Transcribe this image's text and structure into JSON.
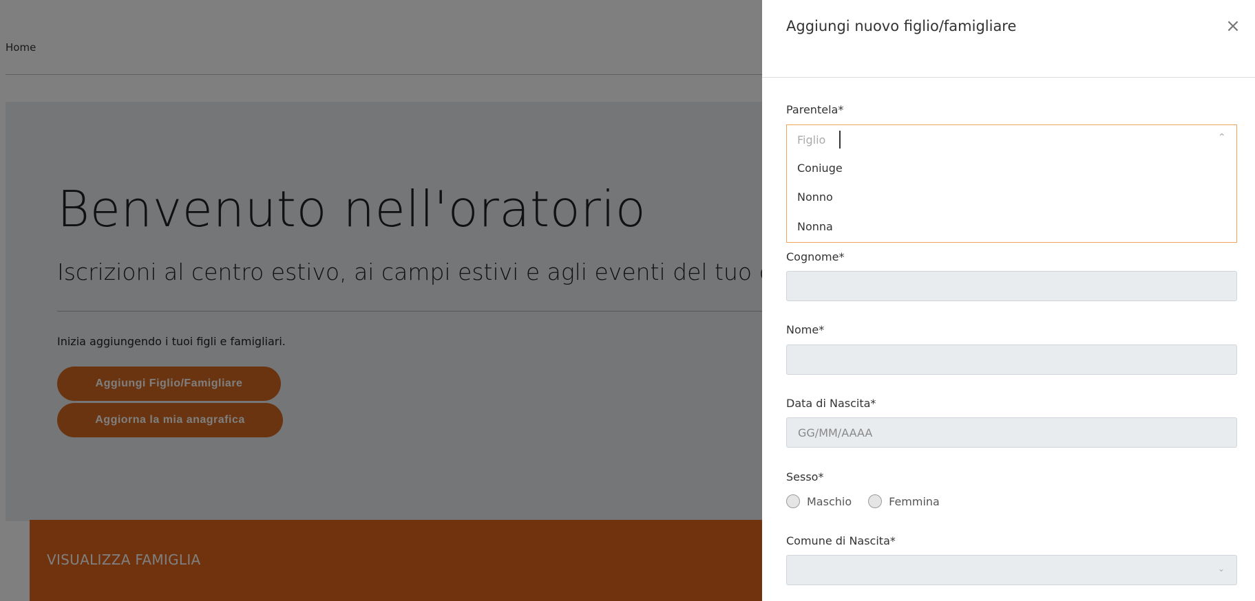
{
  "background": {
    "nav_home": "Home",
    "title": "Benvenuto nell'oratorio",
    "lead": "Iscrizioni al centro estivo, ai campi estivi e agli eventi del tuo orato",
    "intro": "Inizia aggiungendo i tuoi figli e famigliari.",
    "btn_add_child": "Aggiungi Figlio/Famigliare",
    "btn_update_profile": "Aggiorna la mia anagrafica",
    "family_bar": "VISUALIZZA FAMIGLIA",
    "accent_color": "#d2691e"
  },
  "panel": {
    "title": "Aggiungi nuovo figlio/famigliare",
    "close_glyph": "×",
    "parentela": {
      "label": "Parentela*",
      "current_value": "Figlio",
      "options": [
        "Coniuge",
        "Nonno",
        "Nonna"
      ],
      "chevron_glyph": "⌃"
    },
    "cognome": {
      "label": "Cognome*",
      "value": ""
    },
    "nome": {
      "label": "Nome*",
      "value": ""
    },
    "data_nascita": {
      "label": "Data di Nascita*",
      "placeholder": "GG/MM/AAAA"
    },
    "sesso": {
      "label": "Sesso*",
      "options": [
        "Maschio",
        "Femmina"
      ]
    },
    "comune_nascita": {
      "label": "Comune di Nascita*",
      "value": "",
      "chevron_glyph": "⌄"
    }
  }
}
